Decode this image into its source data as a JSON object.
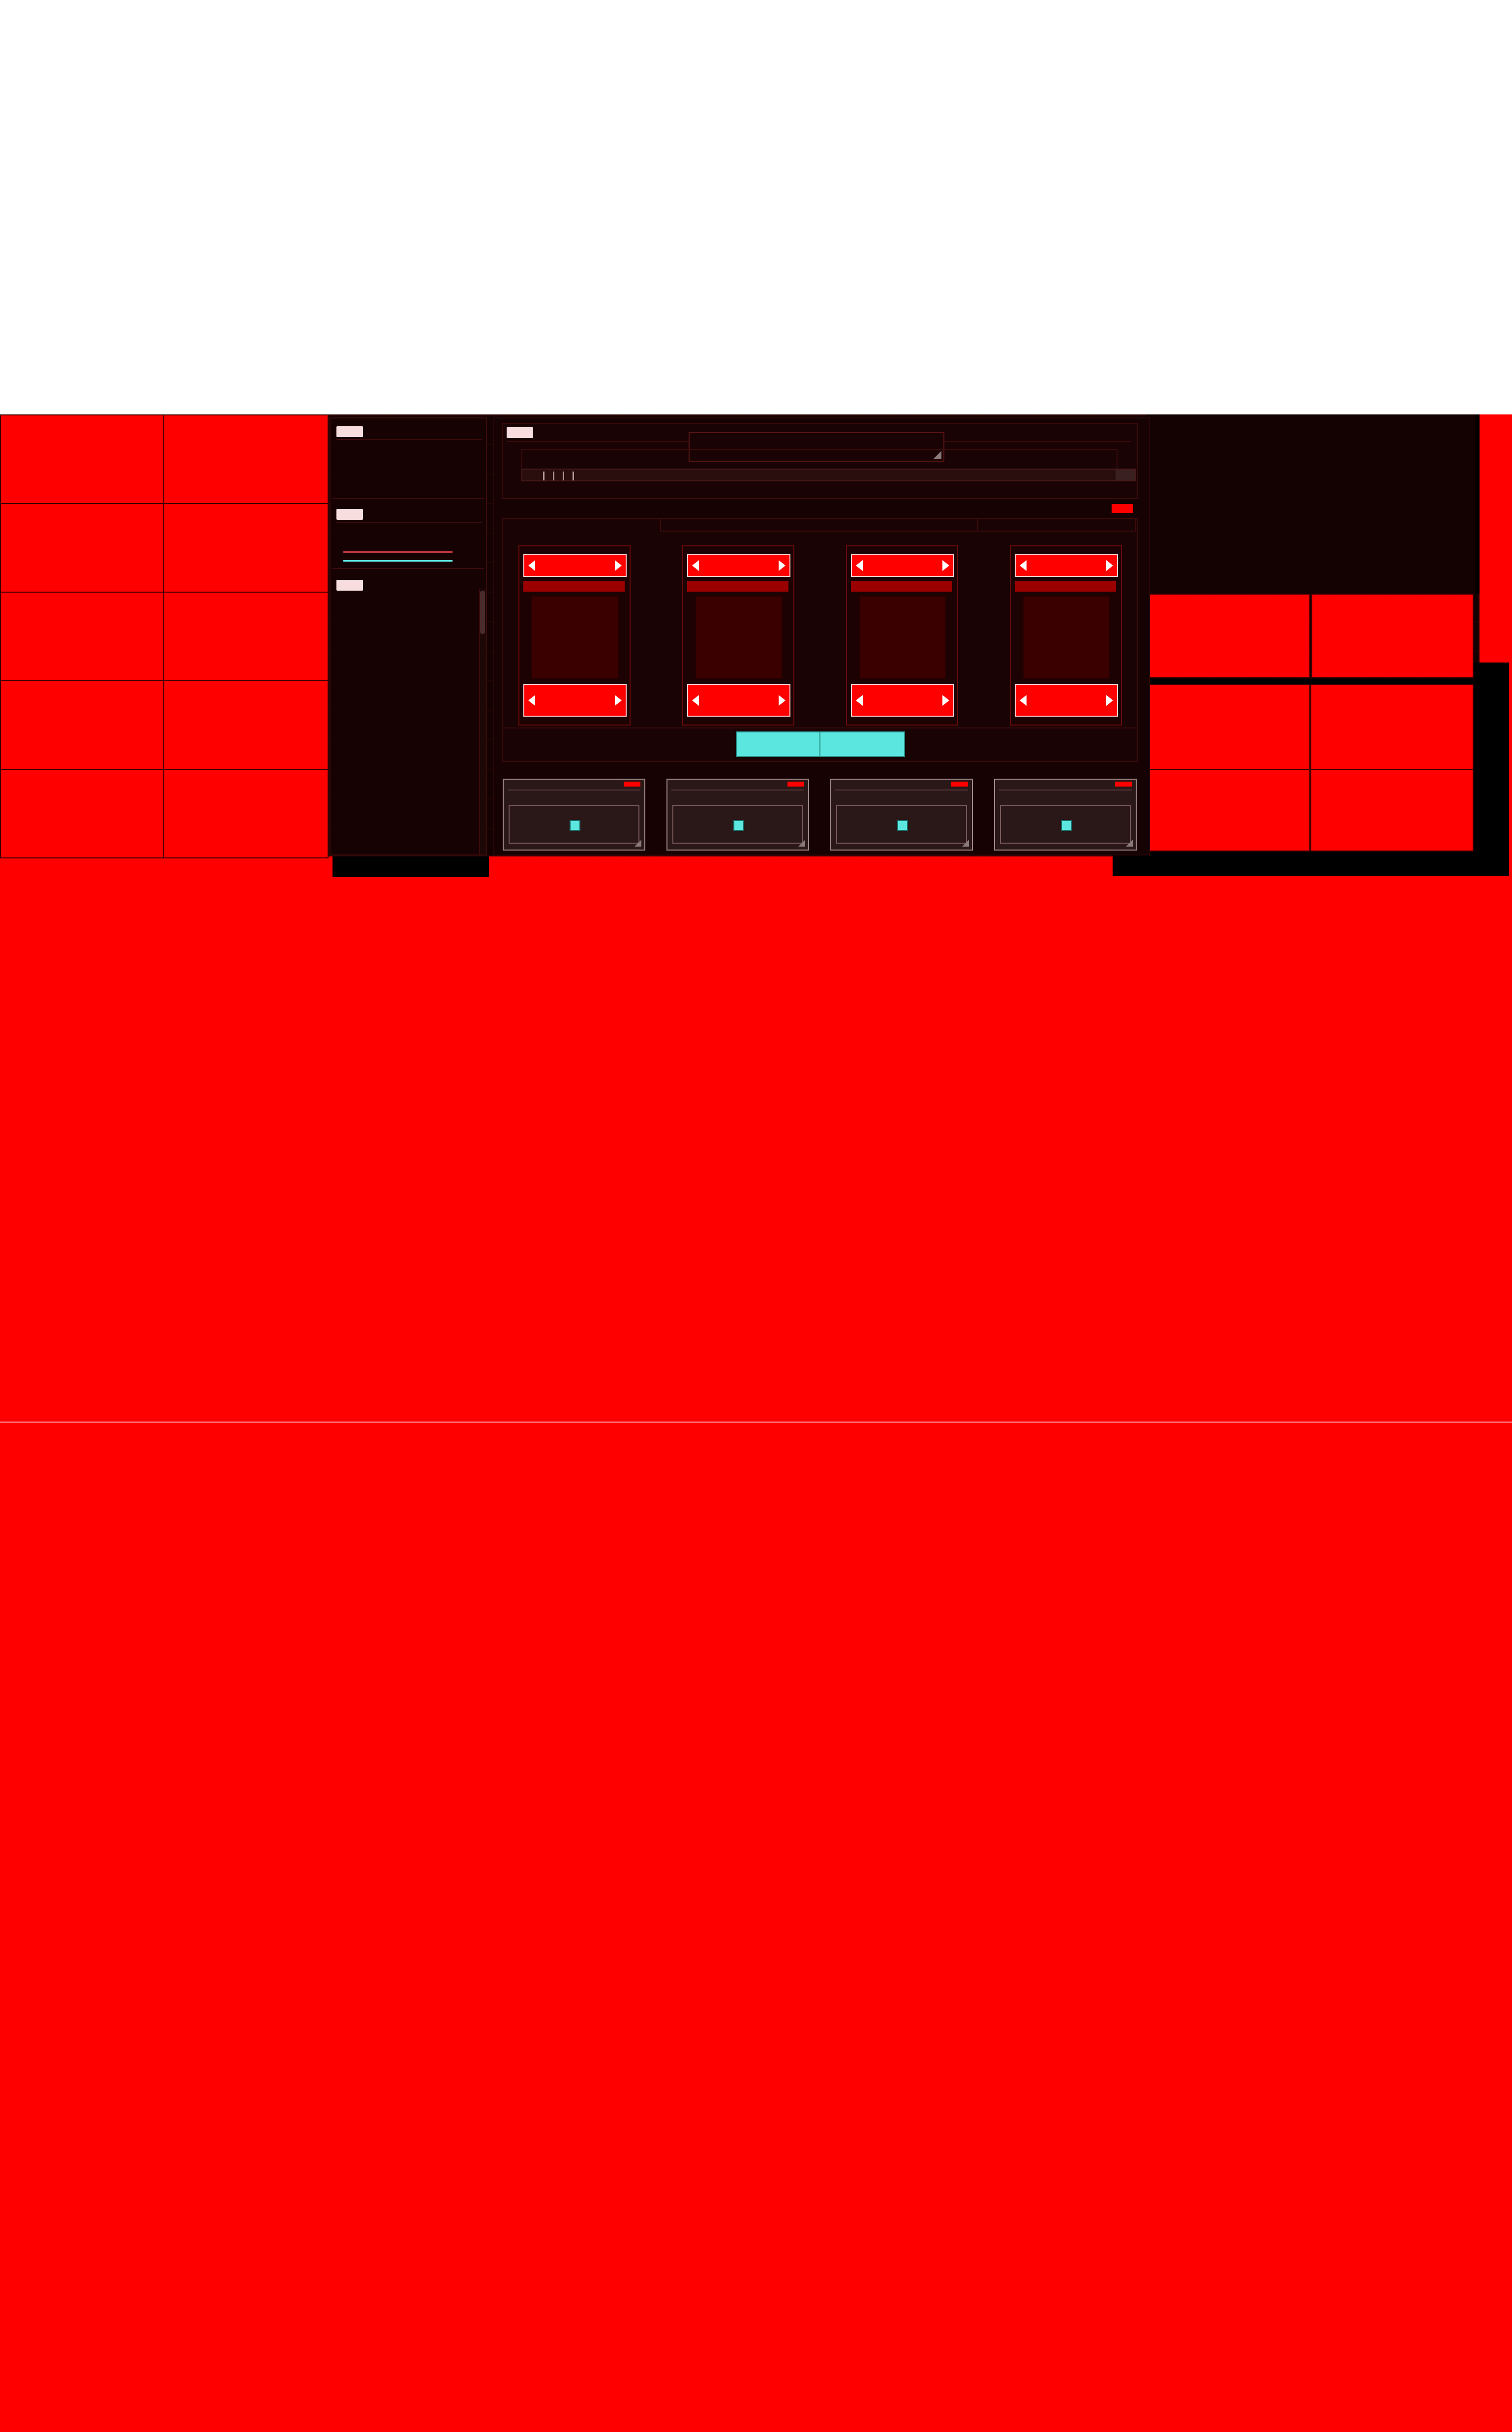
{
  "colors": {
    "background": "#ff0000",
    "frame": "#150102",
    "accent_red": "#ff0000",
    "accent_cyan": "#5ce6e0",
    "pad": "#2a1717",
    "tag": "#f7dddd"
  },
  "sidebar": {
    "sections": [
      {
        "label": ""
      },
      {
        "label": ""
      },
      {
        "label": ""
      }
    ]
  },
  "main": {
    "panel_label": "",
    "display_text": "",
    "timeline_markers": 4,
    "record_indicator": ""
  },
  "channels": [
    {
      "name": "",
      "value": ""
    },
    {
      "name": "",
      "value": ""
    },
    {
      "name": "",
      "value": ""
    },
    {
      "name": "",
      "value": ""
    }
  ],
  "transport": {
    "buttons": [
      {
        "label": ""
      },
      {
        "label": ""
      }
    ]
  },
  "pads": [
    {
      "label": ""
    },
    {
      "label": ""
    },
    {
      "label": ""
    },
    {
      "label": ""
    }
  ],
  "icons": [
    "arrow-left-icon",
    "arrow-right-icon",
    "pad-indicator-icon",
    "resize-corner-icon"
  ]
}
